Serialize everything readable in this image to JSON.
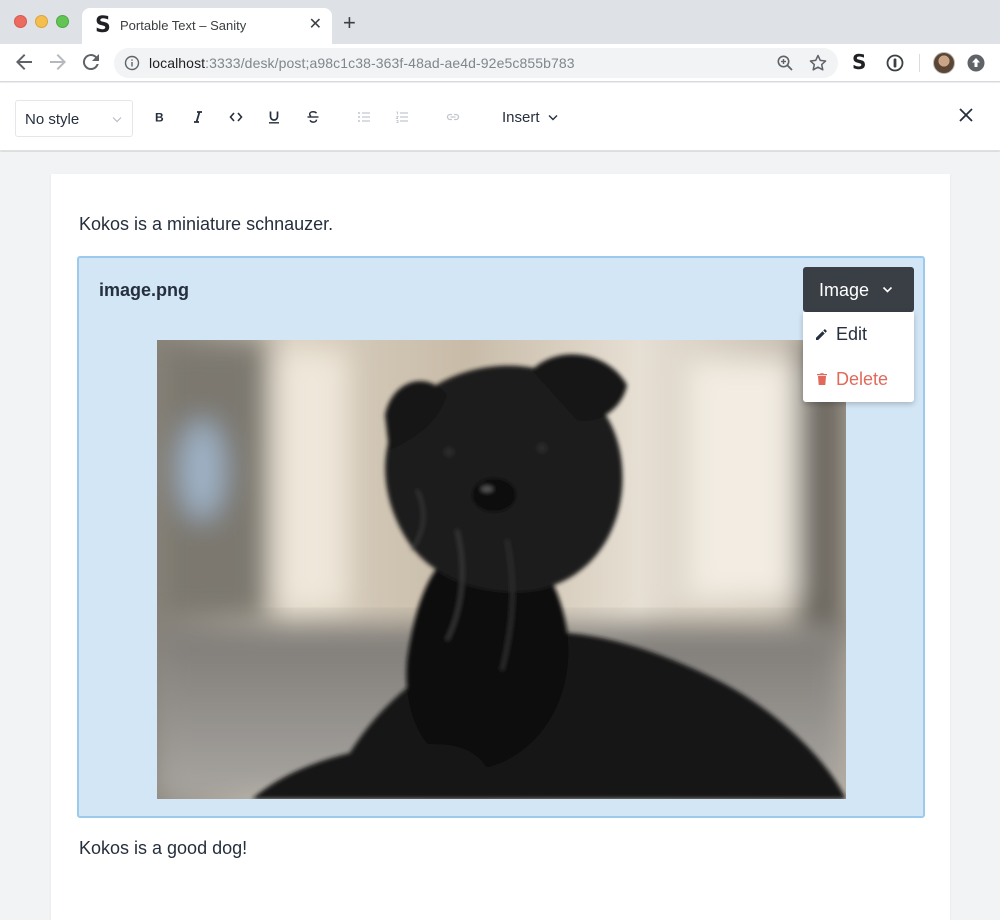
{
  "browser": {
    "tab_title": "Portable Text – Sanity",
    "tab_favicon": "S",
    "new_tab_glyph": "+",
    "close_tab_glyph": "✕",
    "url_host": "localhost",
    "url_rest": ":3333/desk/post;a98c1c38-363f-48ad-ae4d-92e5c855b783",
    "extension_label": "S",
    "icons": [
      "back-arrow-icon",
      "forward-arrow-icon",
      "reload-icon",
      "info-icon",
      "zoom-icon",
      "star-icon",
      "sanity-extension-icon",
      "password-extension-icon",
      "avatar",
      "update-icon"
    ]
  },
  "editor_toolbar": {
    "style_select_value": "No style",
    "insert_label": "Insert",
    "format_buttons": [
      "bold-icon",
      "italic-icon",
      "code-icon",
      "underline-icon",
      "strikethrough-icon",
      "bullet-list-icon",
      "numbered-list-icon",
      "link-icon"
    ],
    "disabled_buttons": [
      "bullet-list-icon",
      "numbered-list-icon",
      "link-icon"
    ]
  },
  "document": {
    "paragraph_1": "Kokos is a miniature schnauzer.",
    "paragraph_2": "Kokos is a good dog!",
    "image_block": {
      "filename": "image.png",
      "menu_button_label": "Image",
      "menu_items": [
        {
          "label": "Edit",
          "icon": "pencil-icon"
        },
        {
          "label": "Delete",
          "icon": "trash-icon"
        }
      ],
      "image_subject": "black miniature schnauzer dog"
    }
  },
  "colors": {
    "block_background": "#d2e6f6",
    "block_border": "#9ccaed",
    "menu_button": "#3a3f45",
    "delete_text": "#e1695b",
    "text": "#262f3d"
  }
}
